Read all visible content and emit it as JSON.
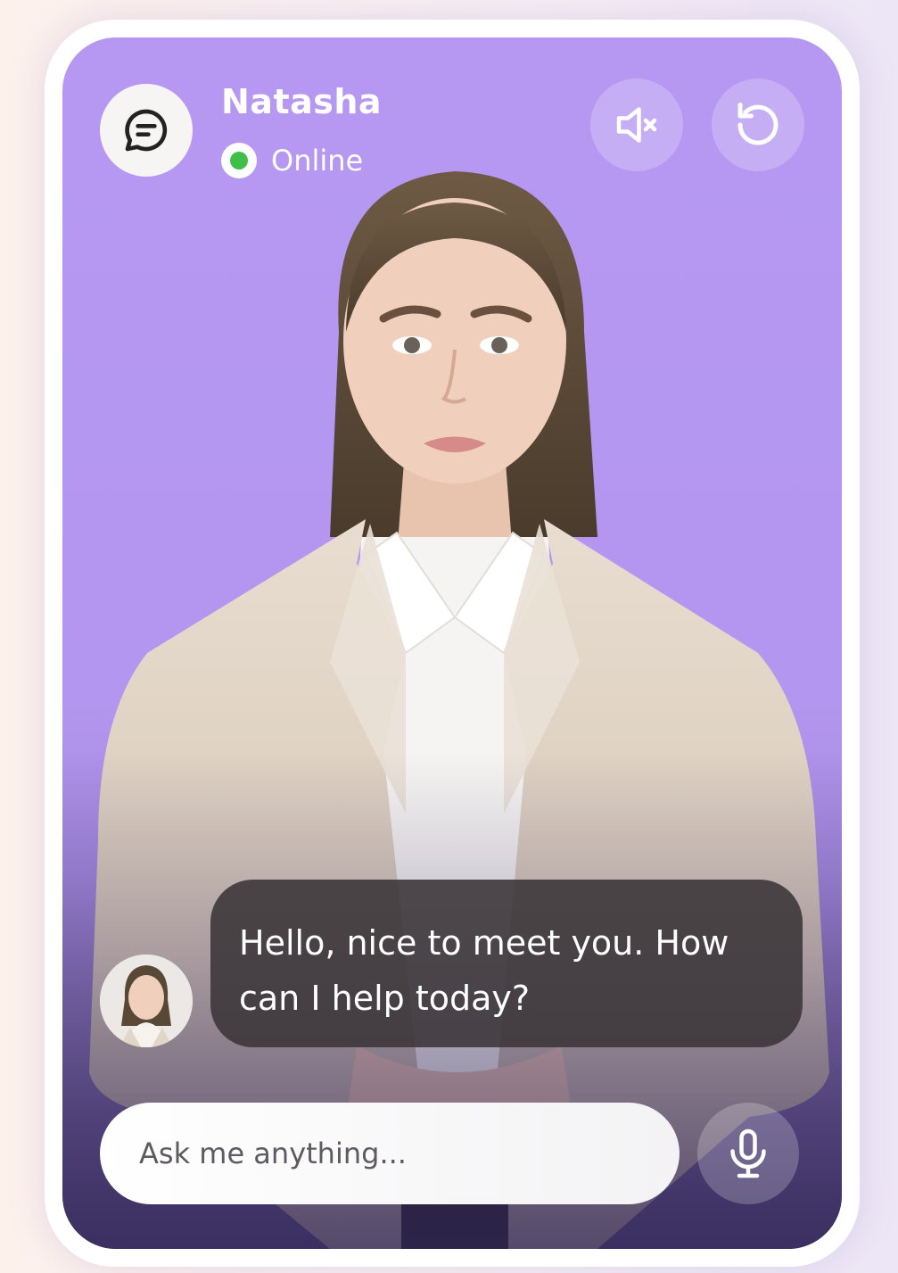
{
  "assistant": {
    "name": "Natasha",
    "status": "Online"
  },
  "icons": {
    "chat": "chat-bubble-icon",
    "mute": "speaker-muted-icon",
    "reset": "refresh-icon",
    "mic": "microphone-icon"
  },
  "message": {
    "text": "Hello, nice to meet you. How can I help today?"
  },
  "input": {
    "placeholder": "Ask me anything..."
  },
  "colors": {
    "card_top": "#b698f2",
    "card_bottom": "#4e4170",
    "online": "#3fbf4a",
    "bubble": "#3a3438"
  }
}
